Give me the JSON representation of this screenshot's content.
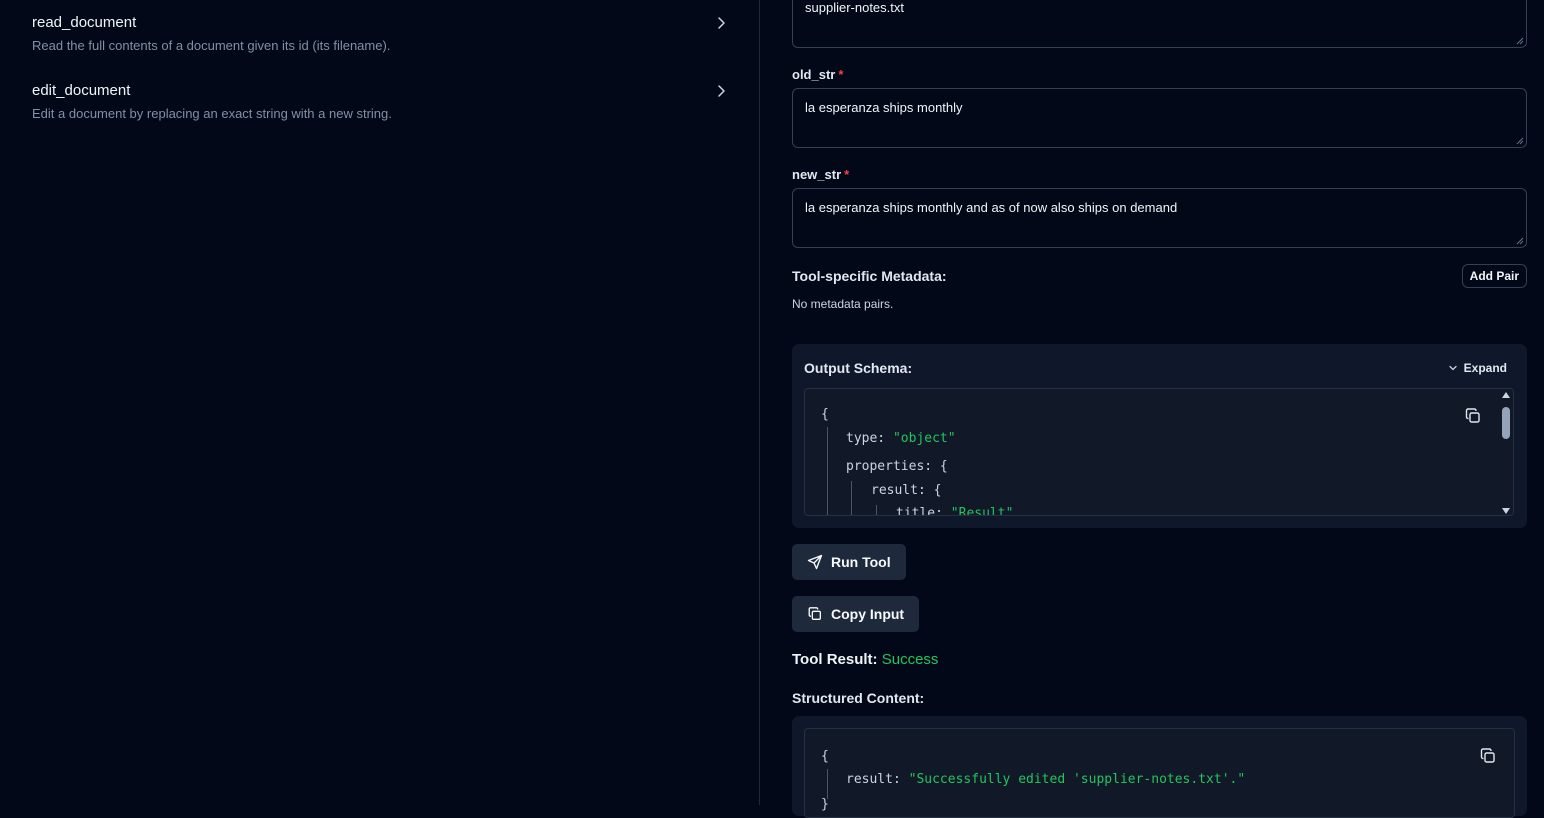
{
  "tools": [
    {
      "name": "read_document",
      "description": "Read the full contents of a document given its id (its filename)."
    },
    {
      "name": "edit_document",
      "description": "Edit a document by replacing an exact string with a new string."
    }
  ],
  "form": {
    "doc_id_value": "supplier-notes.txt",
    "old_str": {
      "label": "old_str",
      "required_mark": "*",
      "value": "la esperanza ships monthly"
    },
    "new_str": {
      "label": "new_str",
      "required_mark": "*",
      "value": "la esperanza ships monthly and as of now also ships on demand"
    }
  },
  "metadata": {
    "label": "Tool-specific Metadata:",
    "add_pair_label": "Add Pair",
    "empty_text": "No metadata pairs."
  },
  "output_schema": {
    "title": "Output Schema:",
    "expand_label": "Expand",
    "lines": [
      {
        "key": "{",
        "value": ""
      },
      {
        "key": "type:",
        "value": "\"object\""
      },
      {
        "key": "properties:",
        "value": "{"
      },
      {
        "key": "result:",
        "value": "{"
      },
      {
        "key": "title:",
        "value": "\"Result\""
      }
    ]
  },
  "actions": {
    "run_tool_label": "Run Tool",
    "copy_input_label": "Copy Input"
  },
  "result": {
    "label": "Tool Result:",
    "status": "Success",
    "structured_label": "Structured Content:",
    "lines": [
      {
        "key": "{",
        "value": ""
      },
      {
        "key": "result:",
        "value": "\"Successfully edited 'supplier-notes.txt'.\""
      },
      {
        "key": "}",
        "value": ""
      }
    ]
  },
  "colors": {
    "background": "#020817",
    "panel": "#0f172a",
    "success": "#22c55e",
    "required": "#ef4444"
  }
}
